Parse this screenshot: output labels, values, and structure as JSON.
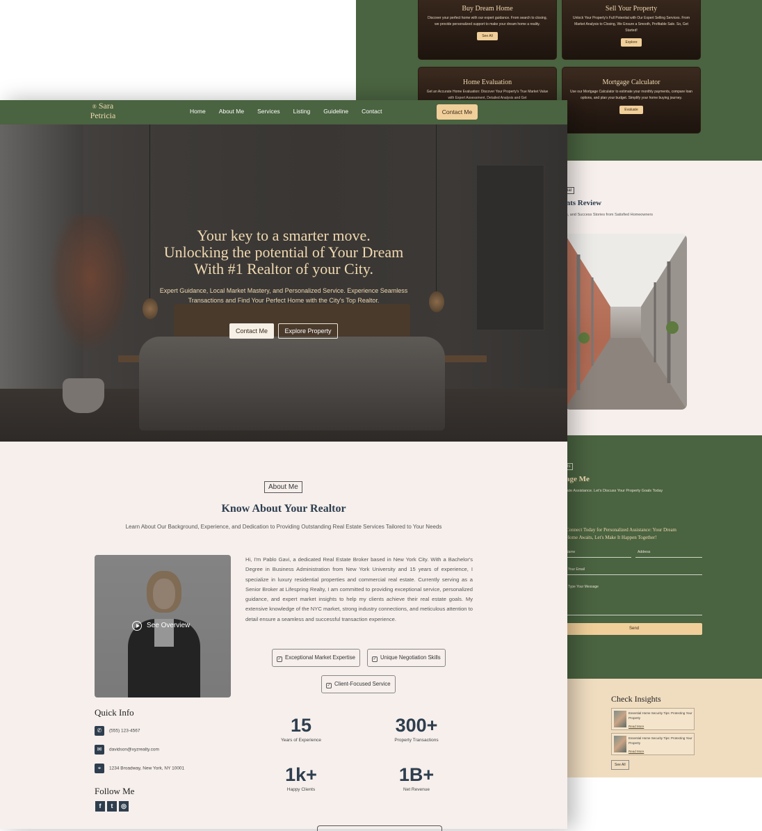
{
  "nav": {
    "logo_mark": "®",
    "logo_line1": "Sara",
    "logo_line2": "Petricia",
    "links": [
      "Home",
      "About Me",
      "Services",
      "Listing",
      "Guideline",
      "Contact"
    ],
    "cta": "Contact Me"
  },
  "hero": {
    "line1": "Your key to a smarter move.",
    "line2": "Unlocking the potential of Your Dream",
    "line3": "With #1 Realtor of your City.",
    "subtitle": "Expert Guidance, Local Market Mastery, and Personalized Service. Experience Seamless Transactions and Find Your Perfect Home with the City's Top Realtor.",
    "btn_primary": "Contact Me",
    "btn_secondary": "Explore Property"
  },
  "about": {
    "tag": "About Me",
    "title": "Know About Your Realtor",
    "subtitle": "Learn About Our Background, Experience, and Dedication to Providing Outstanding Real Estate Services Tailored to Your Needs",
    "overview": "See Overview",
    "paragraph": "Hi, I'm Pablo Gavi, a dedicated Real Estate Broker based in New York City. With a Bachelor's Degree in Business Administration from New York University and 15 years of experience, I specialize in luxury residential properties and commercial real estate. Currently serving as a Senior Broker at Lifespring Realty, I am committed to providing exceptional service, personalized guidance, and expert market insights to help my clients achieve their real estate goals. My extensive knowledge of the NYC market, strong industry connections, and meticulous attention to detail ensure a seamless and successful transaction experience.",
    "chips": [
      "Exceptional Market Expertise",
      "Unique Negotiation Skills",
      "Client-Focused Service"
    ],
    "quick_info_title": "Quick Info",
    "phone": "(555) 123-4567",
    "email": "davidson@xyzrealty.com",
    "address": "1234 Broadway, New York, NY 10001",
    "follow_title": "Follow Me",
    "socials": [
      "f",
      "t",
      "◎"
    ],
    "stats": [
      {
        "value": "15",
        "label": "Years of Experience"
      },
      {
        "value": "300+",
        "label": "Property Transactions"
      },
      {
        "value": "1k+",
        "label": "Happy Clients"
      },
      {
        "value": "1B+",
        "label": "Net Revenue"
      }
    ]
  },
  "services": [
    {
      "title": "Buy Dream Home",
      "desc": "Discover your perfect home with our expert guidance. From search to closing, we provide personalized support to make your dream home a reality.",
      "btn": "See All"
    },
    {
      "title": "Sell Your Property",
      "desc": "Unlock Your Property's Full Potential with Our Expert Selling Services. From Market Analysis to Closing, We Ensure a Smooth, Profitable Sale. So, Get Started!",
      "btn": "Explore"
    },
    {
      "title": "Home Evaluation",
      "desc": "Get an Accurate Home Evaluation: Discover Your Property's True Market Value with Expert Assessment, Detailed Analysis and Get",
      "btn": ""
    },
    {
      "title": "Mortgage Calculator",
      "desc": "Use our Mortgage Calculator to estimate your monthly payments, compare loan options, and plan your budget. Simplify your home buying journey.",
      "btn": "Evaluate"
    }
  ],
  "reviews": {
    "tag": "ial",
    "title": "nts Review",
    "subtitle": "s, and Success Stories from Satisfied Homeowners"
  },
  "engage": {
    "tag": "ls",
    "title": "age Me",
    "subtitle": "tate Assistance. Let's Discuss Your Property Goals Today",
    "lead_line1": "Connect Today for Personalized Assistance: Your Dream",
    "lead_line2": "Home Awaits, Let's Make It Happen Together!",
    "name_ph": "Name",
    "address_ph": "Address",
    "email_ph": "Your Email",
    "message_ph": "Type Your Message",
    "send": "Send"
  },
  "insights": {
    "title": "Check Insights",
    "items": [
      {
        "text": "Essential Home Security Tips: Protecting Your Property",
        "link": "Read More"
      },
      {
        "text": "Essential Home Security Tips: Protecting Your Property",
        "link": "Read More"
      }
    ],
    "see_all": "See All"
  },
  "colors": {
    "green": "#4a6340",
    "cream": "#f1cf9a",
    "navy": "#2e3e4e",
    "blush": "#f6efec"
  }
}
